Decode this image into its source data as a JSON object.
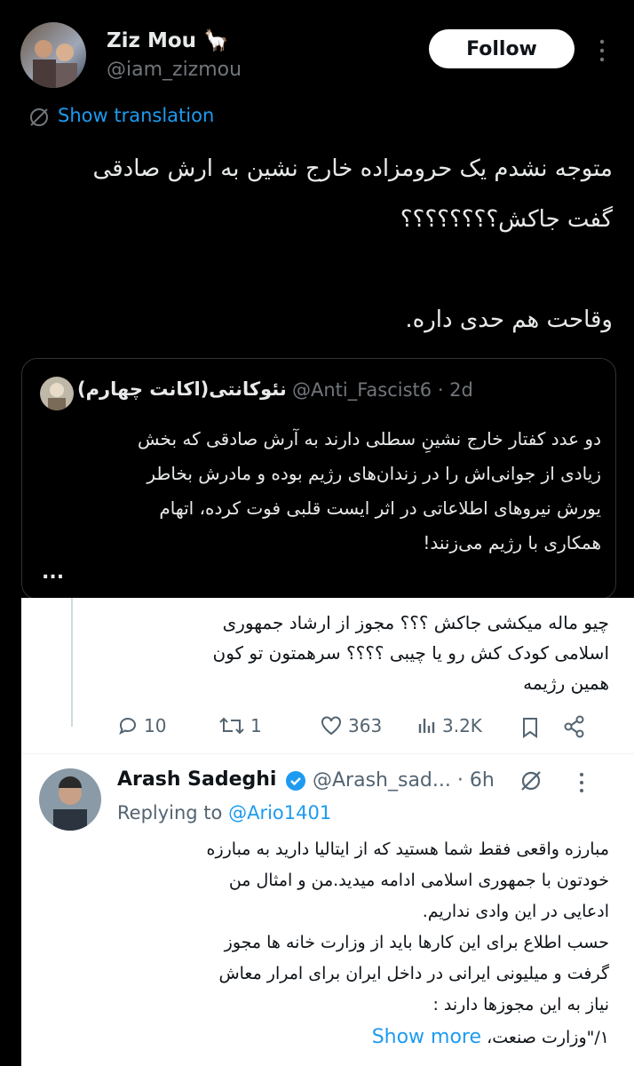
{
  "author": {
    "name": "Ziz Mou",
    "emoji": "🦙",
    "handle": "@iam_zizmou",
    "follow_label": "Follow"
  },
  "translation_label": "Show translation",
  "tweet_lines": [
    "متوجه نشدم یک حرومزاده خارج نشین به ارش صادقی",
    "گفت جاکش؟؟؟؟؟؟؟؟",
    "وقاحت هم حدی داره."
  ],
  "quote": {
    "name": "نئوکانتی(اکانت چهارم)",
    "handle": "@Anti_Fascist6",
    "time": "· 2d",
    "lines": [
      "دو عدد کفتار خارج نشینِ سطلی دارند به آرش صادقی که بخش",
      "زیادی از جوانی‌اش را در زندان‌های رژیم بوده و مادرش بخاطر",
      "یورش نیروهای اطلاعاتی در اثر ایست قلبی فوت کرده، اتهام",
      "همکاری با رژیم می‌زنند!"
    ],
    "more": "..."
  },
  "reply1": {
    "lines": [
      "چیو ماله میکشی جاکش ؟؟؟ مجوز از ارشاد جمهوری",
      "اسلامی کودک کش رو یا چیبی ؟؟؟؟ سرهمتون تو کون",
      "همین رژیمه"
    ],
    "replies": "10",
    "reposts": "1",
    "likes": "363",
    "views": "3.2K"
  },
  "reply2": {
    "name": "Arash Sadeghi",
    "handle": "@Arash_sad...",
    "time": "· 6h",
    "replying_prefix": "Replying to",
    "replying_to": "@Ario1401",
    "lines": [
      "مبارزه واقعی فقط شما هستید که از ایتالیا دارید به مبارزه",
      "خودتون با جمهوری اسلامی ادامه میدید.من و امثال من",
      "ادعایی در این وادی نداریم.",
      "حسب اطلاع برای این کارها باید از وزارت خانه ها مجوز",
      "گرفت و میلیونی ایرانی در داخل ایران برای امرار معاش",
      "نیاز به این مجوزها دارند :"
    ],
    "last_line": "۱/\"وزارت صنعت،",
    "show_more": "Show more"
  },
  "colors": {
    "accent": "#1d9bf0",
    "bg": "#000000"
  }
}
